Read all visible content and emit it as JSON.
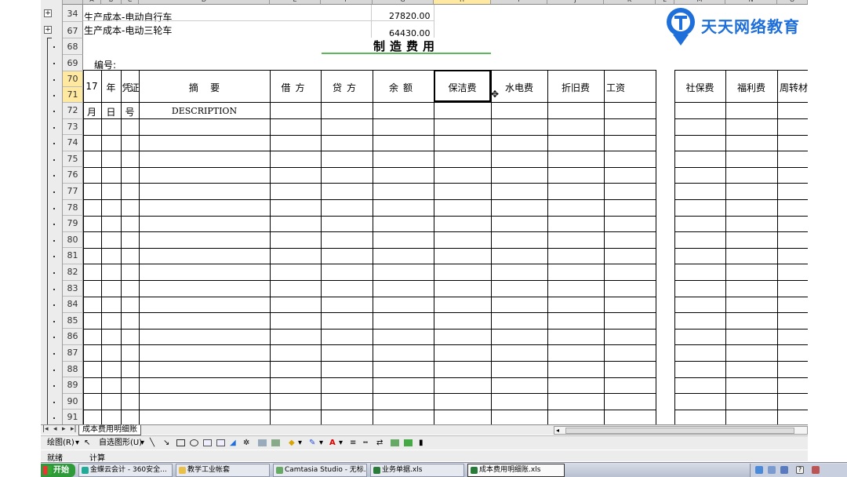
{
  "logo": {
    "text": "天天网络教育"
  },
  "columns": [
    "A",
    "B",
    "C",
    "D",
    "E",
    "F",
    "G",
    "H",
    "I",
    "J",
    "K",
    "L",
    "M",
    "N",
    "O"
  ],
  "rows": {
    "r34": {
      "num": "34",
      "label": "生产成本-电动自行车",
      "value": "27820.00"
    },
    "r67": {
      "num": "67",
      "label": "生产成本-电动三轮车",
      "value": "64430.00"
    },
    "nums": [
      "68",
      "69",
      "70",
      "71",
      "72",
      "73",
      "74",
      "75",
      "76",
      "77",
      "78",
      "79",
      "80",
      "81",
      "82",
      "83",
      "84",
      "85",
      "86",
      "87",
      "88",
      "89",
      "90",
      "91"
    ]
  },
  "sheet": {
    "title": "制造费用",
    "bianhao": "编号:",
    "year": "17",
    "nian": "年",
    "pingzheng": "凭证",
    "zhaiyao": "摘    要",
    "jiefang": "借方",
    "daifang": "贷方",
    "yue": "余额",
    "baojiefei": "保洁费",
    "shuidianfei": "水电费",
    "zhejiufei": "折旧费",
    "gongzi": "工资",
    "shebaofei": "社保费",
    "fulifei": "福利费",
    "zhouzhuan": "周转材",
    "yue2": "月",
    "ri": "日",
    "hao": "号",
    "description": "DESCRIPTION"
  },
  "sheet_tab": {
    "label": "成本费用明细账"
  },
  "draw_toolbar": {
    "draw_label": "绘图(R)",
    "autoshapes_label": "自选图形(U)"
  },
  "status_bar": {
    "ready": "就绪",
    "calc": "计算"
  },
  "taskbar": {
    "start": "开始",
    "items": [
      {
        "label": "金蝶云会计 - 360安全..."
      },
      {
        "label": "教学工业帐套"
      },
      {
        "label": "Camtasia Studio - 无标..."
      },
      {
        "label": "业务单据.xls"
      },
      {
        "label": "成本费用明细账.xls"
      }
    ]
  }
}
